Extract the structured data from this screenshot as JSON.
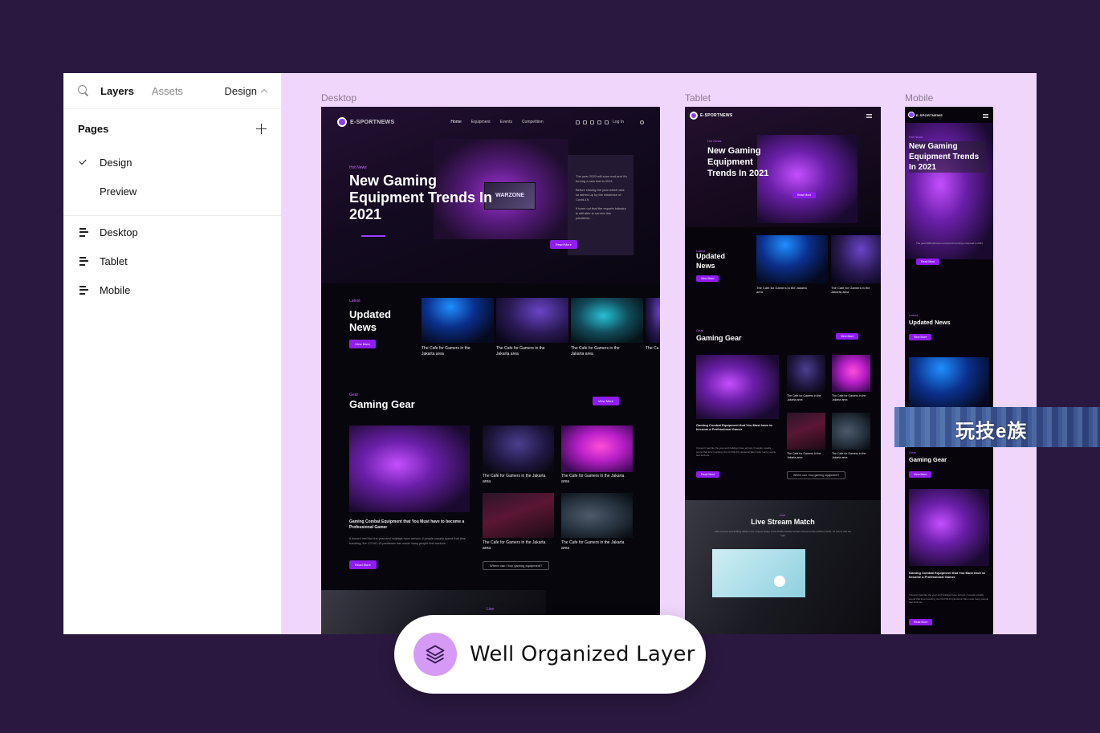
{
  "panel": {
    "tabs": {
      "layers": "Layers",
      "assets": "Assets",
      "design": "Design"
    },
    "pages_heading": "Pages",
    "pages": [
      "Design",
      "Preview"
    ],
    "frames": [
      "Desktop",
      "Tablet",
      "Mobile"
    ]
  },
  "canvas": {
    "labels": {
      "desktop": "Desktop",
      "tablet": "Tablet",
      "mobile": "Mobile"
    }
  },
  "site": {
    "logo": "E-SPORTNEWS",
    "nav": [
      "Home",
      "Equipment",
      "Events",
      "Competition"
    ],
    "login": "Log In",
    "hero_tag": "Hot News",
    "hero_title": "New Gaming Equipment Trends In 2021",
    "hero_screen": "WARZONE",
    "hero_p1": "The year 2020 will soon end and it's turning a new leaf in 2021.",
    "hero_p2": "Before closing the year which was so stirred up by the existence of Covid-19,",
    "hero_p3": "It turns out that the esports industry is still able to survive this pandemic...",
    "read_more": "Read More",
    "latest_tag": "Latest",
    "updated_news": "Updated News",
    "view_more": "View More",
    "news_caption": "The Cafe for Gamers in the Jakarta area",
    "news_caption_short": "The Ca the Jak",
    "gear_tag": "Gear",
    "gaming_gear": "Gaming Gear",
    "gear_main_title": "Gaming Combat Equipment that You Must have to become a Professional Gamer",
    "gear_desc": "It doesn't feel like the year-end holidays have arrived, if people usually spend that time traveling, the COVID-19 pandemic has made many people feel anxious...",
    "gear_cap": "The Cafe for Gamers in the Jakarta area",
    "where_buy": "Where can I buy gaming equipment?",
    "live_tag": "Live",
    "live_title": "Live Stream Match",
    "live_desc": "After a fierce and thrilling battle in the League Stage of the PUBG Mobile Global Championship (PMGC) 2020, 16 teams had the right"
  },
  "watermark": {
    "text": "玩技e族"
  },
  "badge": {
    "label": "Well Organized Layer",
    "icon": "layers-icon"
  }
}
